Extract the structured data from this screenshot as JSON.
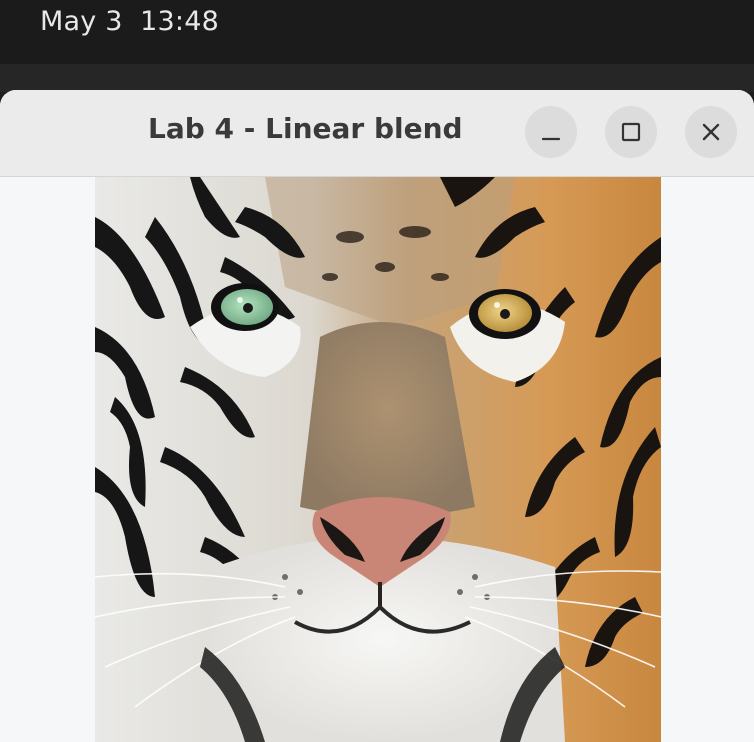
{
  "topbar": {
    "clock": "May 3  13:48"
  },
  "window": {
    "title": "Lab 4 - Linear blend",
    "controls": {
      "minimize": "minimize-icon",
      "maximize": "maximize-icon",
      "close": "close-icon"
    }
  },
  "image": {
    "subject": "tiger face",
    "left_eye_color": "#8ec7a0",
    "right_eye_color": "#d7b35c",
    "fur_colors": [
      "#d69a55",
      "#f2f2f0",
      "#1c1c1c",
      "#a48b6c"
    ],
    "nose_color": "#c98576"
  }
}
